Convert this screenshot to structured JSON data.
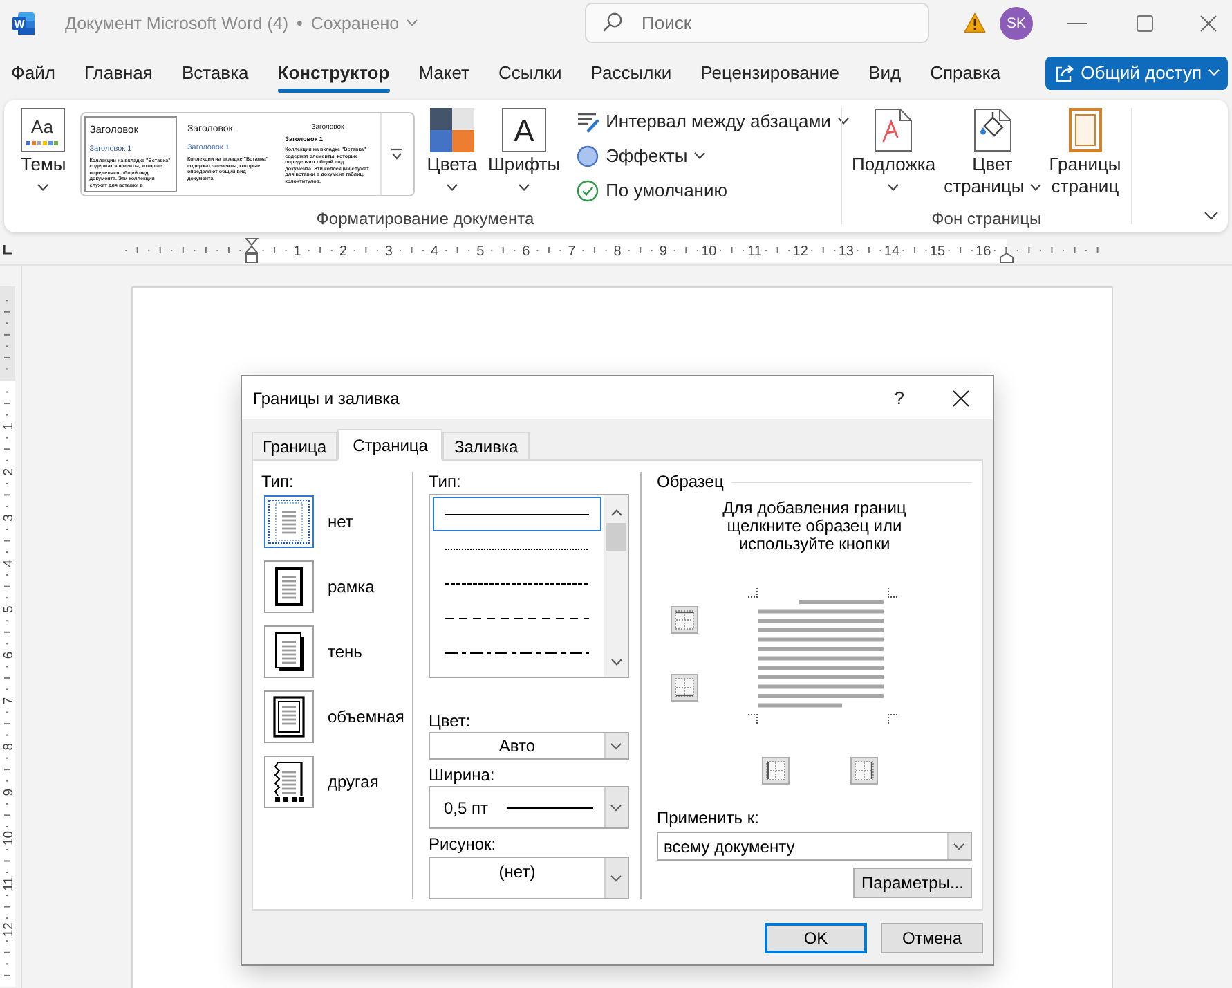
{
  "title_bar": {
    "logo_text": "W",
    "document_name": "Документ Microsoft Word (4)",
    "separator": "•",
    "save_status": "Сохранено"
  },
  "search": {
    "placeholder": "Поиск"
  },
  "account": {
    "initials": "SK"
  },
  "menu_tabs": [
    {
      "label": "Файл",
      "selected": false
    },
    {
      "label": "Главная",
      "selected": false
    },
    {
      "label": "Вставка",
      "selected": false
    },
    {
      "label": "Конструктор",
      "selected": true
    },
    {
      "label": "Макет",
      "selected": false
    },
    {
      "label": "Ссылки",
      "selected": false
    },
    {
      "label": "Рассылки",
      "selected": false
    },
    {
      "label": "Рецензирование",
      "selected": false
    },
    {
      "label": "Вид",
      "selected": false
    },
    {
      "label": "Справка",
      "selected": false
    }
  ],
  "share_button": {
    "label": "Общий доступ"
  },
  "ribbon": {
    "themes": {
      "icon_text": "Aa",
      "label_lines": [
        "Темы"
      ],
      "has_menu": true
    },
    "style_gallery": [
      {
        "kind": "classic",
        "selected": true,
        "title": "Заголовок",
        "heading": "Заголовок 1",
        "body": "Коллекции на вкладке \"Вставка\" содержат элементы, которые определяют общий вид документа. Эти коллекции служат для вставки в"
      },
      {
        "kind": "basic",
        "selected": false,
        "title": "Заголовок",
        "heading": "Заголовок 1",
        "body": "Коллекции на вкладке \"Вставка\" содержат элементы, которые определяют общий вид документа."
      },
      {
        "kind": "centered",
        "selected": false,
        "title": "Заголовок",
        "heading": "Заголовок 1",
        "body": "Коллекции на вкладке \"Вставка\" содержат элементы, которые определяют общий вид документа. Эти коллекции служат для вставки в документ таблиц, колонтитулов,"
      }
    ],
    "colors": {
      "label_lines": [
        "Цвета"
      ],
      "has_menu": true
    },
    "fonts": {
      "icon_text": "A",
      "label_lines": [
        "Шрифты"
      ],
      "has_menu": true
    },
    "commands": [
      {
        "kind": "spacing",
        "label": "Интервал между абзацами",
        "has_menu": true
      },
      {
        "kind": "effects",
        "label": "Эффекты",
        "has_menu": true
      },
      {
        "kind": "default",
        "label": "По умолчанию",
        "has_menu": false
      }
    ],
    "page_background": [
      {
        "kind": "watermark",
        "label_lines": [
          "Подложка"
        ],
        "has_menu": true
      },
      {
        "kind": "page_color",
        "label_lines": [
          "Цвет",
          "страницы"
        ],
        "has_menu": true
      },
      {
        "kind": "page_borders",
        "label_lines": [
          "Границы",
          "страниц"
        ],
        "has_menu": false
      }
    ],
    "group_labels": [
      "Форматирование документа",
      "Фон страницы"
    ]
  },
  "ruler": {
    "numbers": [
      "1",
      "2",
      "3",
      "4",
      "5",
      "6",
      "7",
      "8",
      "9",
      "10",
      "11",
      "12",
      "13",
      "14",
      "15",
      "16"
    ]
  },
  "vertical_ruler": {
    "numbers": [
      "1",
      "2",
      "3",
      "4",
      "5",
      "6",
      "7",
      "8",
      "9",
      "10",
      "11",
      "12"
    ]
  },
  "dialog": {
    "title": "Границы и заливка",
    "help": "?",
    "tabs": [
      {
        "label": "Граница",
        "selected": false
      },
      {
        "label": "Страница",
        "selected": true
      },
      {
        "label": "Заливка",
        "selected": false
      }
    ],
    "setting": {
      "label": "Тип:",
      "options": [
        {
          "kind": "none",
          "label": "нет",
          "selected": true
        },
        {
          "kind": "box",
          "label": "рамка",
          "selected": false
        },
        {
          "kind": "shadow",
          "label": "тень",
          "selected": false
        },
        {
          "kind": "three_d",
          "label": "объемная",
          "selected": false
        },
        {
          "kind": "custom",
          "label": "другая",
          "selected": false
        }
      ]
    },
    "style": {
      "label": "Тип:",
      "options": [
        {
          "kind": "solid",
          "selected": true
        },
        {
          "kind": "dotted",
          "selected": false
        },
        {
          "kind": "dashed_fine",
          "selected": false
        },
        {
          "kind": "dashed",
          "selected": false
        },
        {
          "kind": "dash_dot",
          "selected": false
        }
      ]
    },
    "color": {
      "label": "Цвет:",
      "value": "Авто"
    },
    "width": {
      "label": "Ширина:",
      "value": "0,5 пт"
    },
    "art": {
      "label": "Рисунок:",
      "value": "(нет)"
    },
    "preview": {
      "label": "Образец",
      "hint": "Для добавления границ щелкните образец или используйте кнопки",
      "buttons": [
        {
          "kind": "top"
        },
        {
          "kind": "bottom"
        },
        {
          "kind": "left"
        },
        {
          "kind": "right"
        }
      ]
    },
    "apply_to": {
      "label": "Применить к:",
      "value": "всему документу"
    },
    "options_button": "Параметры...",
    "buttons": [
      {
        "label": "OK",
        "default": true
      },
      {
        "label": "Отмена",
        "default": false
      }
    ]
  }
}
